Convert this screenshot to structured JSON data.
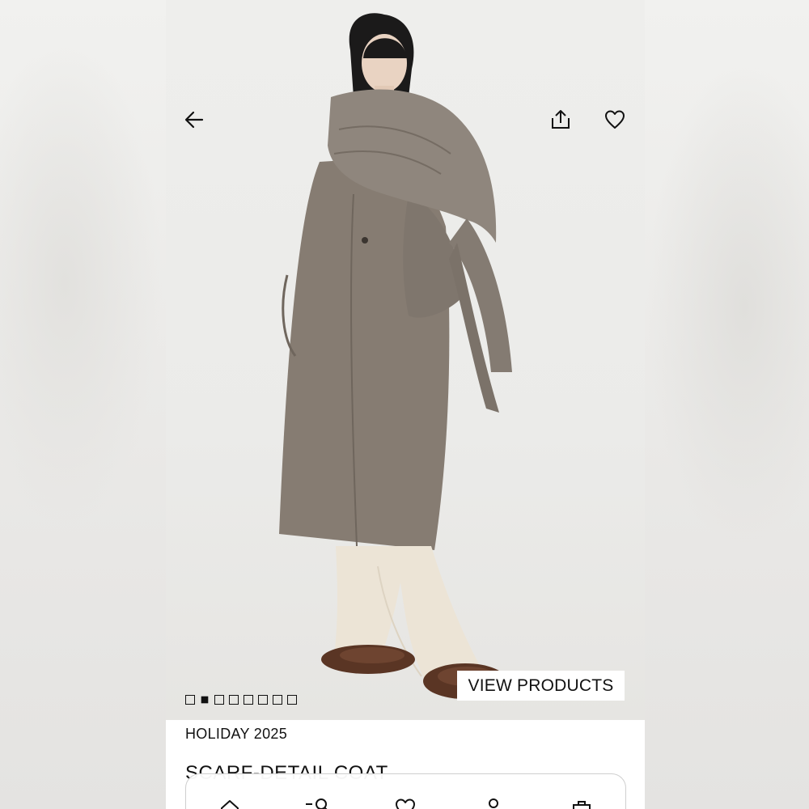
{
  "hero": {
    "carousel": {
      "total": 8,
      "active_index": 1
    },
    "view_products_label": "VIEW PRODUCTS"
  },
  "topbar": {
    "back_icon": "arrow-left-icon",
    "share_icon": "share-icon",
    "favorite_icon": "heart-icon"
  },
  "product": {
    "collection": "HOLIDAY 2025",
    "title": "SCARF-DETAIL COAT"
  },
  "bottom_nav": {
    "items": [
      {
        "icon": "home-icon"
      },
      {
        "icon": "search-icon"
      },
      {
        "icon": "heart-icon"
      },
      {
        "icon": "user-icon"
      },
      {
        "icon": "bag-icon"
      }
    ]
  },
  "colors": {
    "text": "#111111",
    "background": "#ffffff",
    "photo_backdrop": "#ebebe9",
    "coat": "#8a8178"
  }
}
